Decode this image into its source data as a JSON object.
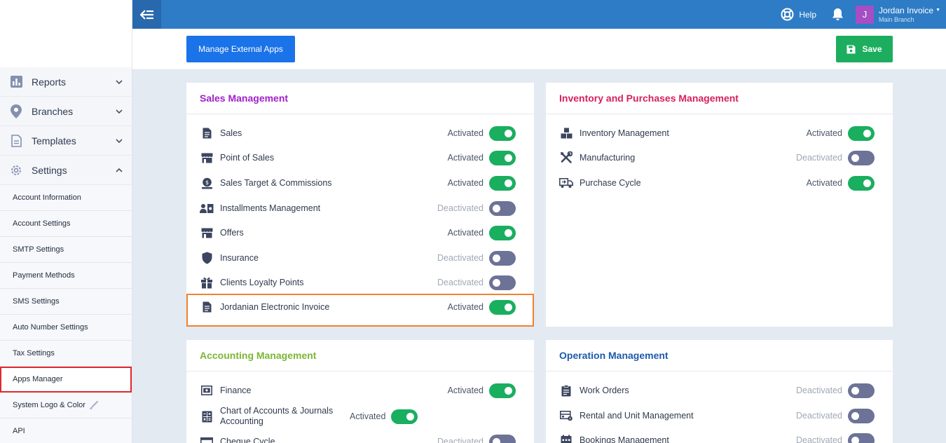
{
  "sidebar": {
    "nav": [
      {
        "label": "Reports",
        "icon": "bar-chart-icon"
      },
      {
        "label": "Branches",
        "icon": "map-pin-icon"
      },
      {
        "label": "Templates",
        "icon": "document-icon"
      },
      {
        "label": "Settings",
        "icon": "gear-icon",
        "expanded": true
      }
    ],
    "sub_items": [
      {
        "label": "Account Information"
      },
      {
        "label": "Account Settings"
      },
      {
        "label": "SMTP Settings"
      },
      {
        "label": "Payment Methods"
      },
      {
        "label": "SMS Settings"
      },
      {
        "label": "Auto Number Settings"
      },
      {
        "label": "Tax Settings"
      },
      {
        "label": "Apps Manager",
        "active": true
      },
      {
        "label": "System Logo & Color"
      },
      {
        "label": "API"
      }
    ]
  },
  "topbar": {
    "help_label": "Help",
    "user_initial": "J",
    "user_name": "Jordan Invoice",
    "branch": "Main Branch"
  },
  "actions": {
    "manage_external_label": "Manage External Apps",
    "save_label": "Save"
  },
  "colors": {
    "topbar": "#2e7cc5",
    "primary_button": "#1a73e8",
    "save_button": "#1cae5e",
    "toggle_on": "#1aae5f",
    "toggle_off": "#6d7297",
    "highlight_orange": "#f0822e",
    "highlight_red": "#e0282f",
    "sales_title": "#a020c8",
    "inventory_title": "#d61f5f",
    "accounting_title": "#7cb534",
    "operation_title": "#1d5aa8"
  },
  "sections": {
    "sales": {
      "title": "Sales Management",
      "items": [
        {
          "label": "Sales",
          "status": "Activated",
          "on": true,
          "icon": "invoice-icon"
        },
        {
          "label": "Point of Sales",
          "status": "Activated",
          "on": true,
          "icon": "store-icon"
        },
        {
          "label": "Sales Target & Commissions",
          "status": "Activated",
          "on": true,
          "icon": "target-coin-icon"
        },
        {
          "label": "Installments Management",
          "status": "Deactivated",
          "on": false,
          "icon": "installments-icon"
        },
        {
          "label": "Offers",
          "status": "Activated",
          "on": true,
          "icon": "store-icon"
        },
        {
          "label": "Insurance",
          "status": "Deactivated",
          "on": false,
          "icon": "shield-icon"
        },
        {
          "label": "Clients Loyalty Points",
          "status": "Deactivated",
          "on": false,
          "icon": "gift-icon"
        },
        {
          "label": "Jordanian Electronic Invoice",
          "status": "Activated",
          "on": true,
          "icon": "invoice-icon"
        }
      ]
    },
    "inventory": {
      "title": "Inventory and Purchases Management",
      "items": [
        {
          "label": "Inventory Management",
          "status": "Activated",
          "on": true,
          "icon": "boxes-icon"
        },
        {
          "label": "Manufacturing",
          "status": "Deactivated",
          "on": false,
          "icon": "tools-icon"
        },
        {
          "label": "Purchase Cycle",
          "status": "Activated",
          "on": true,
          "icon": "truck-icon"
        }
      ]
    },
    "accounting": {
      "title": "Accounting Management",
      "items": [
        {
          "label": "Finance",
          "status": "Activated",
          "on": true,
          "icon": "money-icon"
        },
        {
          "label": "Chart of Accounts & Journals Accounting",
          "status": "Activated",
          "on": true,
          "icon": "calculator-icon"
        },
        {
          "label": "Cheque Cycle",
          "status": "Deactivated",
          "on": false,
          "icon": "cheque-icon"
        }
      ]
    },
    "operation": {
      "title": "Operation Management",
      "items": [
        {
          "label": "Work Orders",
          "status": "Deactivated",
          "on": false,
          "icon": "clipboard-icon"
        },
        {
          "label": "Rental and Unit Management",
          "status": "Deactivated",
          "on": false,
          "icon": "rental-icon"
        },
        {
          "label": "Bookings Management",
          "status": "Deactivated",
          "on": false,
          "icon": "calendar-icon"
        }
      ]
    }
  }
}
